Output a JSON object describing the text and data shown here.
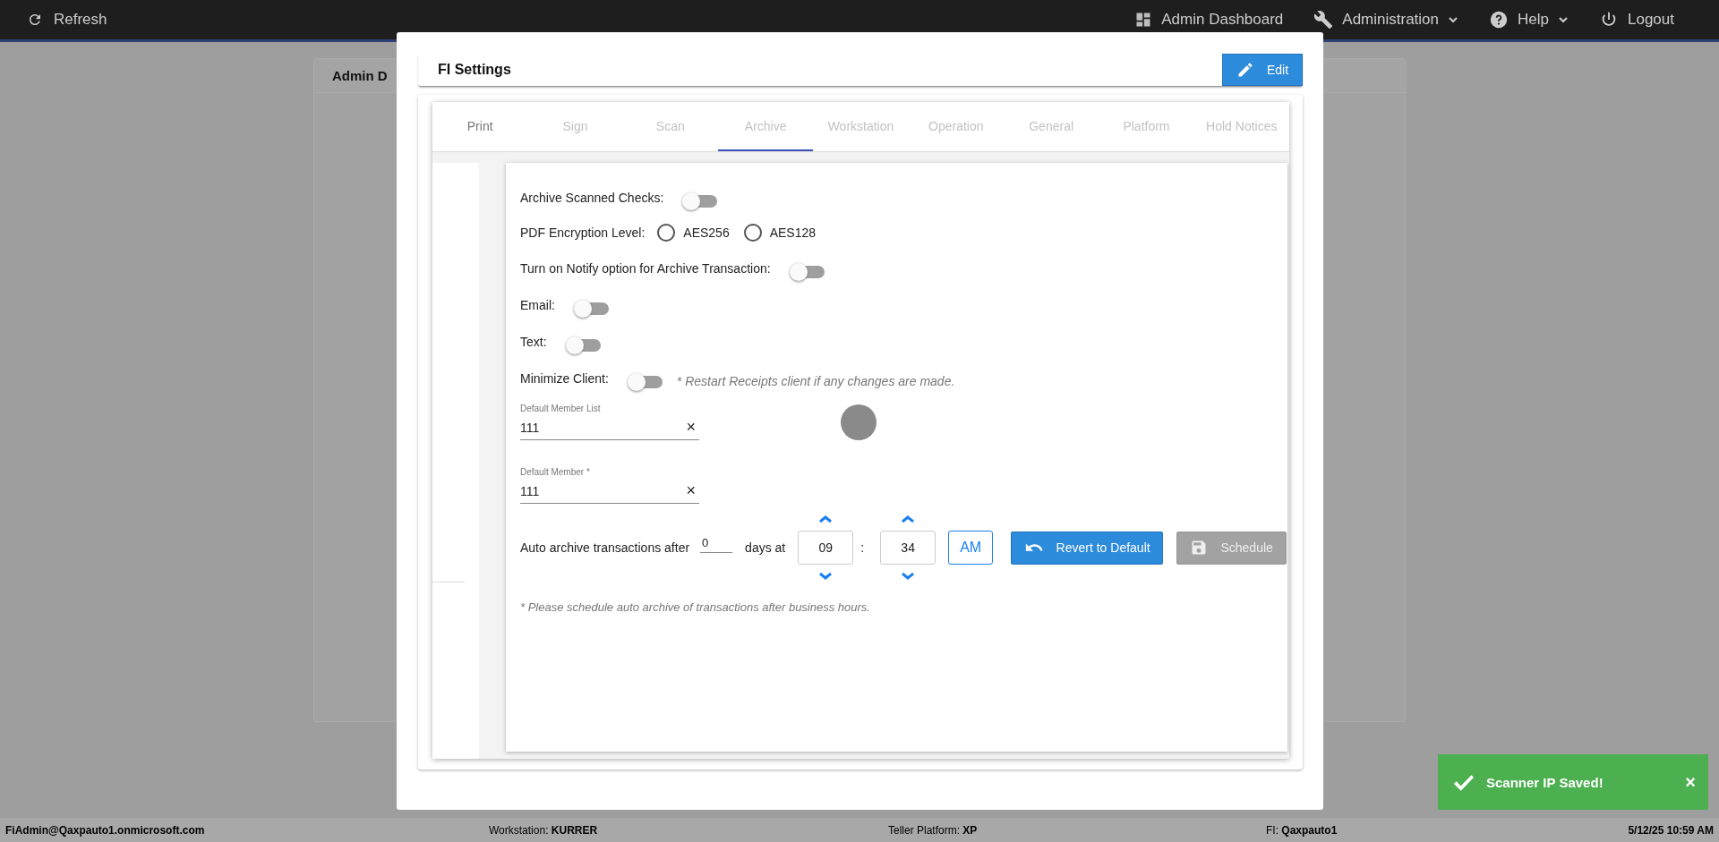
{
  "top_bar": {
    "refresh": "Refresh",
    "items": [
      {
        "label": "Admin Dashboard",
        "dropdown": false
      },
      {
        "label": "Administration",
        "dropdown": true
      },
      {
        "label": "Help",
        "dropdown": true
      },
      {
        "label": "Logout",
        "dropdown": false
      }
    ]
  },
  "background": {
    "tab": "Admin D"
  },
  "modal": {
    "title": "FI Settings",
    "edit_button": "Edit",
    "tabs": [
      {
        "label": "Print",
        "selected": false,
        "disabled": false
      },
      {
        "label": "Sign",
        "selected": false,
        "disabled": true
      },
      {
        "label": "Scan",
        "selected": false,
        "disabled": true
      },
      {
        "label": "Archive",
        "selected": true,
        "disabled": true
      },
      {
        "label": "Workstation",
        "selected": false,
        "disabled": true
      },
      {
        "label": "Operation",
        "selected": false,
        "disabled": true
      },
      {
        "label": "General",
        "selected": false,
        "disabled": true
      },
      {
        "label": "Platform",
        "selected": false,
        "disabled": true
      },
      {
        "label": "Hold Notices",
        "selected": false,
        "disabled": true
      }
    ],
    "rows": [
      {
        "kind": "toggle",
        "label": "Archive Scanned Checks:",
        "on": false
      },
      {
        "kind": "radio",
        "label": "PDF Encryption Level:",
        "options": [
          {
            "label": "AES256",
            "selected": false
          },
          {
            "label": "AES128",
            "selected": false
          }
        ]
      },
      {
        "kind": "toggle",
        "label": "Turn on Notify option for Archive Transaction:",
        "on": false
      },
      {
        "kind": "toggle",
        "label": "Email:",
        "on": false
      },
      {
        "kind": "toggle",
        "label": "Text:",
        "on": false
      },
      {
        "kind": "toggle",
        "label": "Minimize Client:",
        "on": false,
        "note": "* Restart Receipts client if any changes are made."
      }
    ],
    "fields": [
      {
        "label": "Default Member List",
        "value": "111",
        "clear": "×"
      },
      {
        "label": "Default Member *",
        "value": "111",
        "clear": "×"
      }
    ],
    "schedule": {
      "label_before": "Auto archive transactions after",
      "days": "0",
      "label_days": "days at",
      "hour": "09",
      "separator": ":",
      "minute": "34",
      "ampm": "AM",
      "revert_button": "Revert to Default",
      "schedule_button": "Schedule",
      "schedule_disabled": true
    },
    "note": "* Please schedule auto archive of transactions after business hours."
  },
  "toast": {
    "message": "Scanner IP Saved!",
    "close": "×"
  },
  "status_bar": {
    "user": "FiAdmin@Qaxpauto1.onmicrosoft.com",
    "items": [
      {
        "label": "Workstation:",
        "value": "KURRER"
      },
      {
        "label": "Teller Platform:",
        "value": "XP"
      },
      {
        "label": "FI:",
        "value": "Qaxpauto1"
      }
    ],
    "datetime": "5/12/25 10:59 AM"
  }
}
